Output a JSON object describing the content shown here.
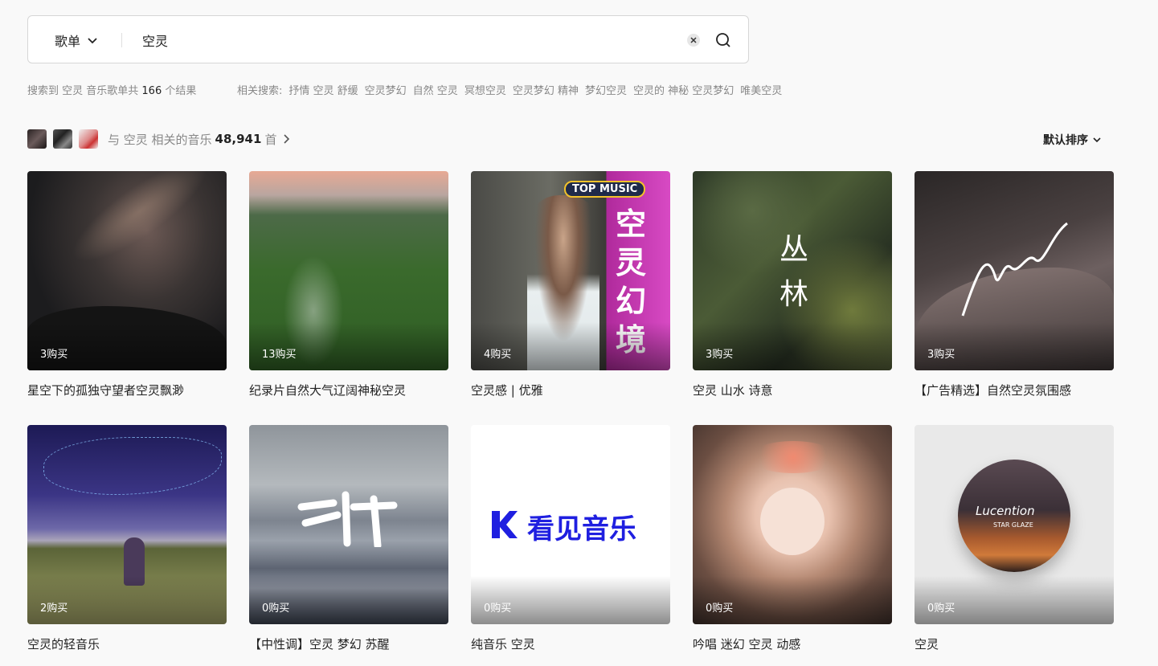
{
  "search": {
    "type_label": "歌单",
    "query": "空灵"
  },
  "summary": {
    "prefix": "搜索到 空灵 音乐歌单共",
    "count": "166",
    "suffix": "个结果"
  },
  "related": {
    "label": "相关搜索:",
    "items": [
      "抒情 空灵 舒缓",
      "空灵梦幻",
      "自然 空灵",
      "冥想空灵",
      "空灵梦幻 精神",
      "梦幻空灵",
      "空灵的 神秘 空灵梦幻",
      "唯美空灵"
    ]
  },
  "music": {
    "prefix": "与 空灵 相关的音乐",
    "count": "48,941",
    "suffix": "首"
  },
  "sort": {
    "label": "默认排序"
  },
  "playlists": [
    {
      "buy": "3购买",
      "title": "星空下的孤独守望者空灵飘渺"
    },
    {
      "buy": "13购买",
      "title": "纪录片自然大气辽阔神秘空灵"
    },
    {
      "buy": "4购买",
      "title": "空灵感 | 优雅",
      "cover_badge": "TOP MUSIC",
      "cover_text": "空灵幻境"
    },
    {
      "buy": "3购买",
      "title": "空灵 山水 诗意",
      "cover_text": "丛林"
    },
    {
      "buy": "3购买",
      "title": "【广告精选】自然空灵氛围感"
    },
    {
      "buy": "2购买",
      "title": "空灵的轻音乐"
    },
    {
      "buy": "0购买",
      "title": "【中性调】空灵 梦幻 苏醒"
    },
    {
      "buy": "0购买",
      "title": "纯音乐 空灵",
      "cover_text": "看见音乐"
    },
    {
      "buy": "0购买",
      "title": "吟唱 迷幻 空灵 动感"
    },
    {
      "buy": "0购买",
      "title": "空灵",
      "cover_text": "Lucention",
      "cover_sub": "STAR GLAZE"
    }
  ]
}
